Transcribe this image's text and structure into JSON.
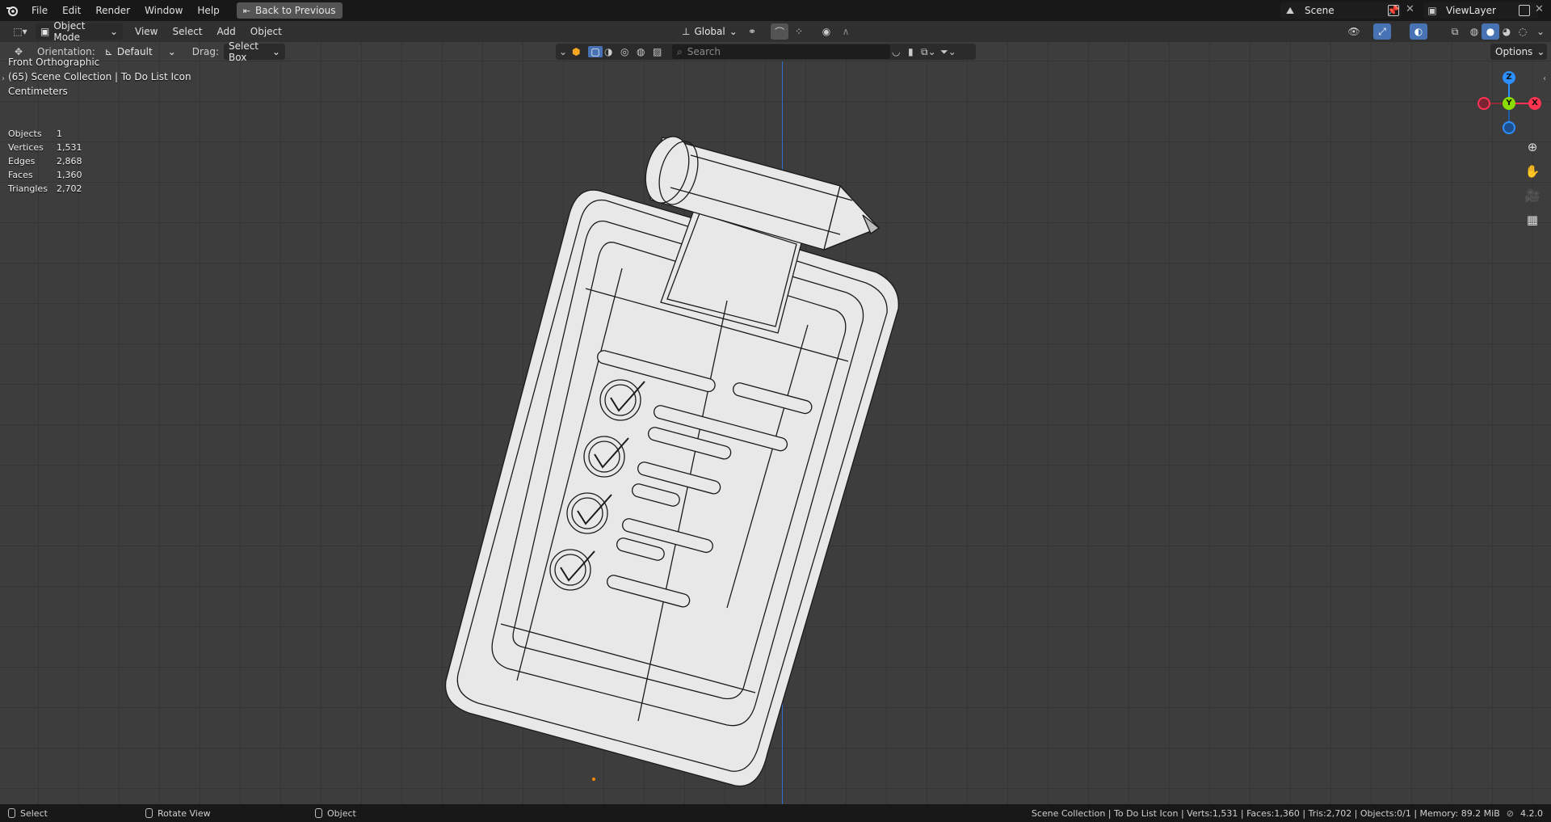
{
  "menu": {
    "items": [
      "File",
      "Edit",
      "Render",
      "Window",
      "Help"
    ],
    "back_button": "Back to Previous"
  },
  "scene": {
    "name": "Scene",
    "view_layer": "ViewLayer"
  },
  "header": {
    "mode": "Object Mode",
    "menus": [
      "View",
      "Select",
      "Add",
      "Object"
    ],
    "orientation_transform": "Global",
    "search_placeholder": "Search",
    "options": "Options"
  },
  "tool_settings": {
    "orientation_label": "Orientation:",
    "orientation_value": "Default",
    "drag_label": "Drag:",
    "drag_value": "Select Box"
  },
  "viewport": {
    "view_name": "Front Orthographic",
    "collection": "(65) Scene Collection | To Do List Icon",
    "units": "Centimeters",
    "stats": [
      {
        "key": "Objects",
        "value": "1"
      },
      {
        "key": "Vertices",
        "value": "1,531"
      },
      {
        "key": "Edges",
        "value": "2,868"
      },
      {
        "key": "Faces",
        "value": "1,360"
      },
      {
        "key": "Triangles",
        "value": "2,702"
      }
    ],
    "gizmo": {
      "z": "Z",
      "y": "Y",
      "x": "X"
    }
  },
  "statusbar": {
    "left": [
      {
        "icon": "mouse-left-icon",
        "label": "Select"
      },
      {
        "icon": "mouse-middle-icon",
        "label": "Rotate View"
      },
      {
        "icon": "mouse-right-icon",
        "label": "Object"
      }
    ],
    "info": "Scene Collection | To Do List Icon | Verts:1,531 | Faces:1,360 | Tris:2,702 | Objects:0/1 | Memory: 89.2 MiB",
    "version": "4.2.0"
  },
  "colors": {
    "axis_x": "#ff3352",
    "axis_y": "#8bdc00",
    "axis_z": "#2c8fff",
    "accent": "#4772b3"
  }
}
